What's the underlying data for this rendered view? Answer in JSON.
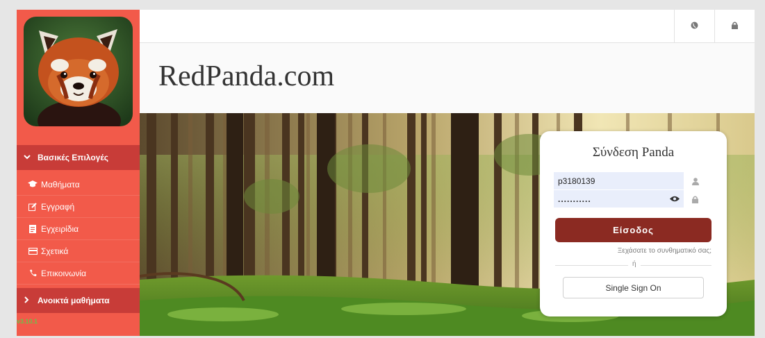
{
  "sidebar": {
    "section_header": "Βασικές Επιλογές",
    "items": [
      {
        "label": "Μαθήματα",
        "icon": "graduation-cap-icon"
      },
      {
        "label": "Εγγραφή",
        "icon": "edit-icon"
      },
      {
        "label": "Εγχειρίδια",
        "icon": "document-icon"
      },
      {
        "label": "Σχετικά",
        "icon": "credit-card-icon"
      },
      {
        "label": "Επικοινωνία",
        "icon": "phone-icon"
      }
    ],
    "open_courses": "Ανοικτά μαθήματα",
    "version": "v3.10.1"
  },
  "header": {
    "brand": "RedPanda.com",
    "language_icon": "globe-icon",
    "lock_icon": "lock-icon"
  },
  "login": {
    "title": "Σύνδεση Panda",
    "username": "p3180139",
    "password_mask": "...........",
    "submit_label": "Είσοδος",
    "forgot_label": "Ξεχάσατε το συνθηματικό σας;",
    "or_label": "ή",
    "sso_label": "Single Sign On"
  },
  "colors": {
    "sidebar": "#f25a4a",
    "sidebar_header": "#c83c38",
    "login_button": "#8b2a22"
  }
}
